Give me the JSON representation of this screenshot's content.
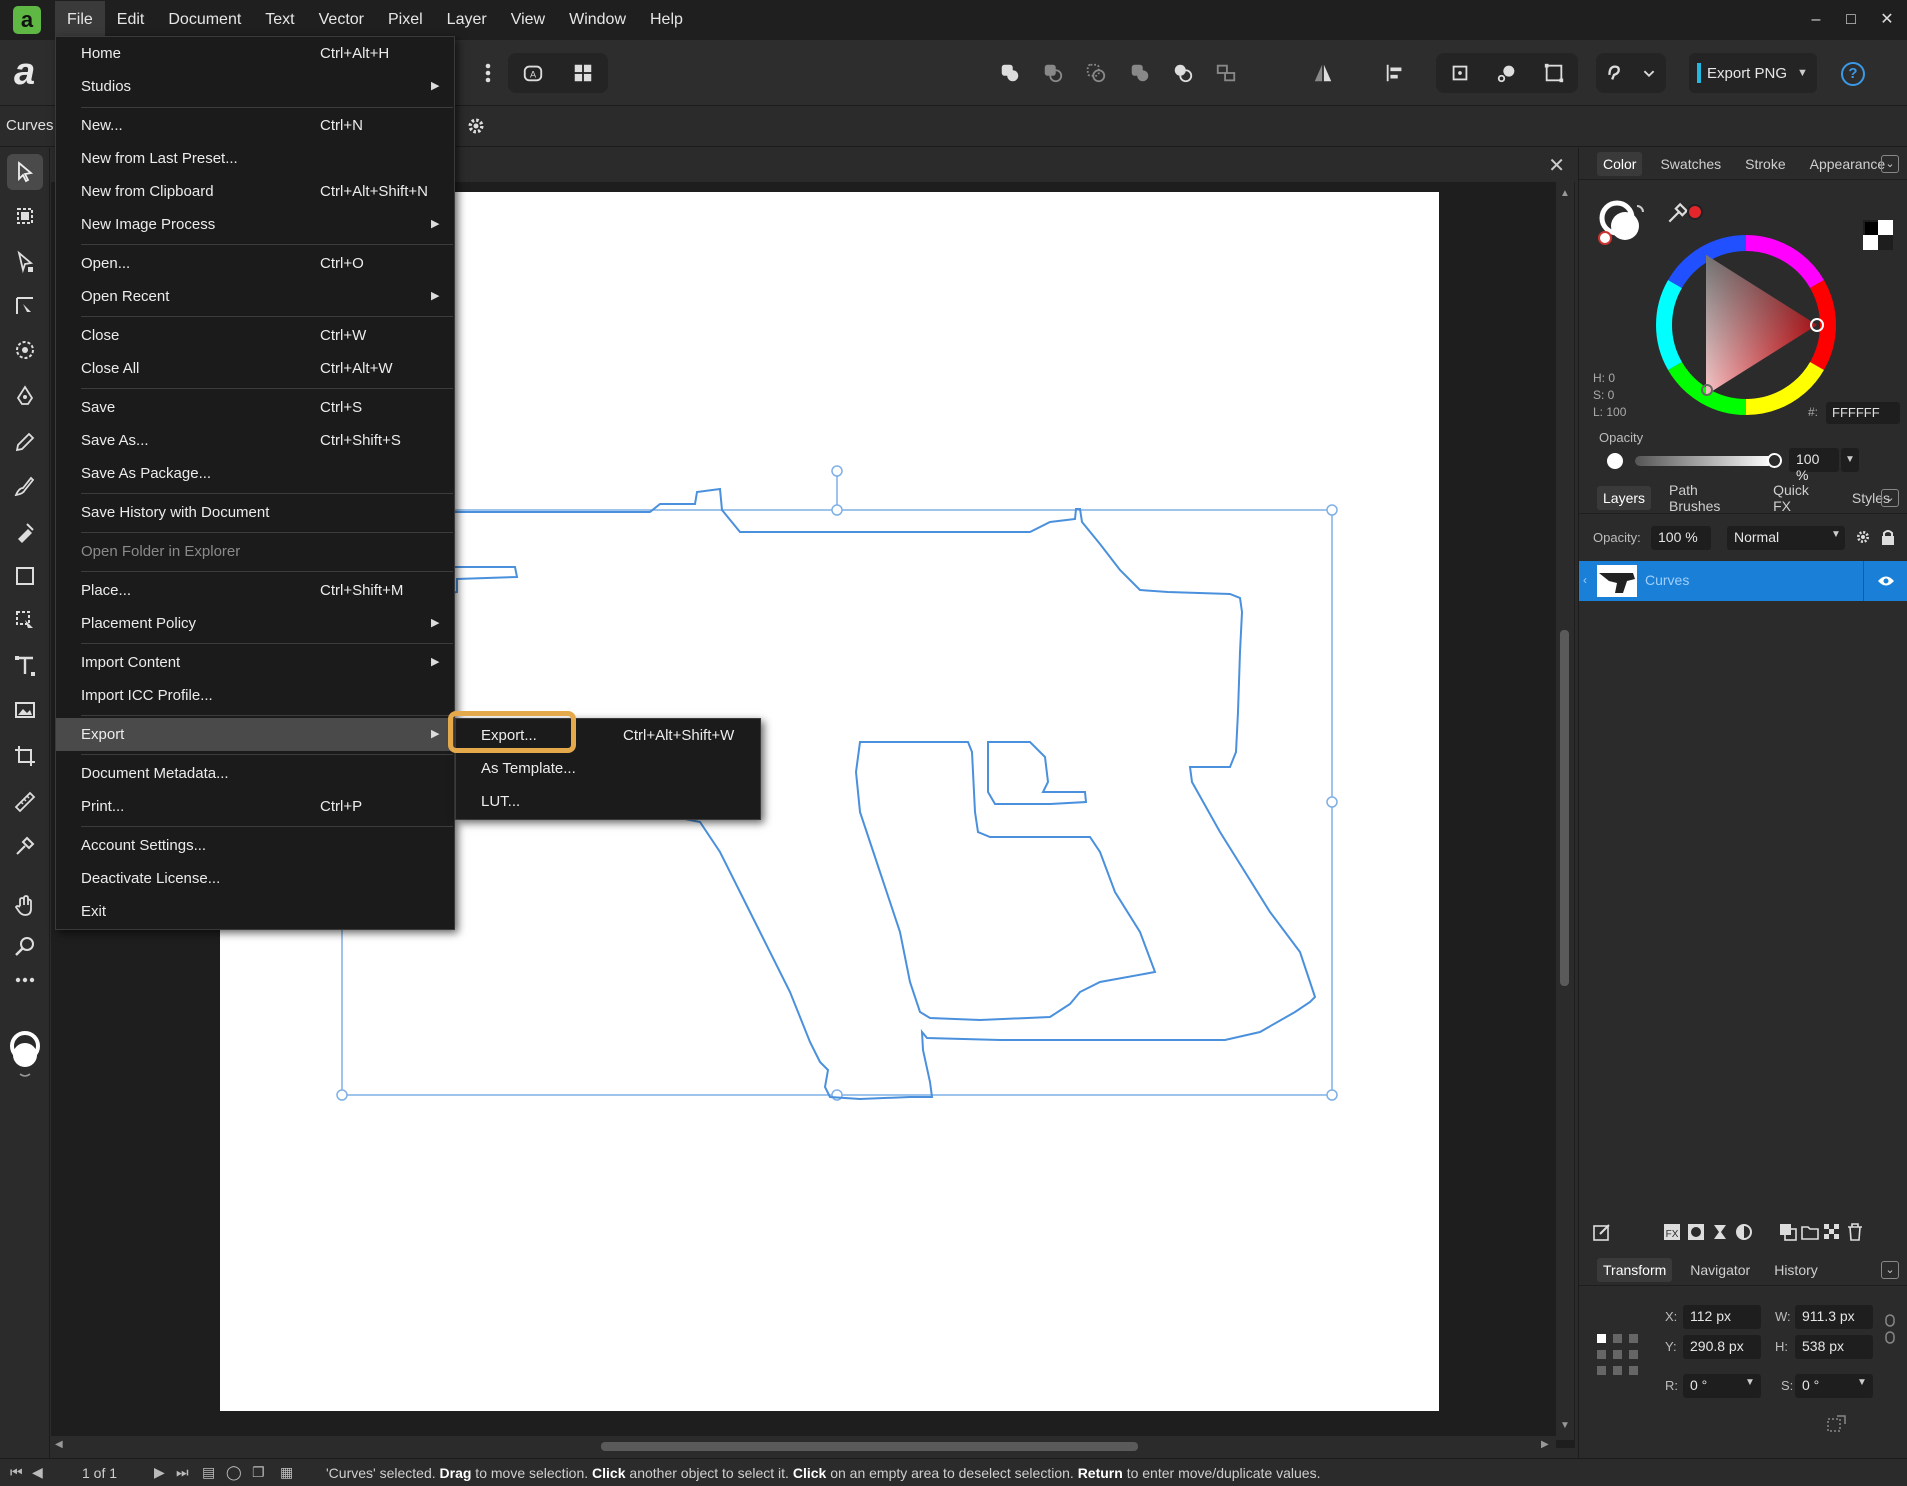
{
  "menubar": {
    "logo": "a",
    "items": [
      "File",
      "Edit",
      "Document",
      "Text",
      "Vector",
      "Pixel",
      "Layer",
      "View",
      "Window",
      "Help"
    ],
    "active": "File"
  },
  "toolbar": {
    "export_label": "Export PNG",
    "help": "?"
  },
  "context": {
    "label": "Curves"
  },
  "file_menu": {
    "items": [
      {
        "label": "Home",
        "shortcut": "Ctrl+Alt+H"
      },
      {
        "label": "Studios",
        "submenu": true
      },
      {
        "label": "New...",
        "shortcut": "Ctrl+N"
      },
      {
        "label": "New from Last Preset..."
      },
      {
        "label": "New from Clipboard",
        "shortcut": "Ctrl+Alt+Shift+N"
      },
      {
        "label": "New Image Process",
        "submenu": true
      },
      {
        "label": "Open...",
        "shortcut": "Ctrl+O"
      },
      {
        "label": "Open Recent",
        "submenu": true
      },
      {
        "label": "Close",
        "shortcut": "Ctrl+W"
      },
      {
        "label": "Close All",
        "shortcut": "Ctrl+Alt+W"
      },
      {
        "label": "Save",
        "shortcut": "Ctrl+S"
      },
      {
        "label": "Save As...",
        "shortcut": "Ctrl+Shift+S"
      },
      {
        "label": "Save As Package..."
      },
      {
        "label": "Save History with Document"
      },
      {
        "label": "Open Folder in Explorer",
        "disabled": true
      },
      {
        "label": "Place...",
        "shortcut": "Ctrl+Shift+M"
      },
      {
        "label": "Placement Policy",
        "submenu": true
      },
      {
        "label": "Import Content",
        "submenu": true
      },
      {
        "label": "Import ICC Profile..."
      },
      {
        "label": "Export",
        "submenu": true,
        "highlighted": true
      },
      {
        "label": "Document Metadata..."
      },
      {
        "label": "Print...",
        "shortcut": "Ctrl+P"
      },
      {
        "label": "Account Settings..."
      },
      {
        "label": "Deactivate License..."
      },
      {
        "label": "Exit"
      }
    ]
  },
  "export_submenu": {
    "items": [
      {
        "label": "Export...",
        "shortcut": "Ctrl+Alt+Shift+W"
      },
      {
        "label": "As Template..."
      },
      {
        "label": "LUT..."
      }
    ]
  },
  "color_panel": {
    "tabs": [
      "Color",
      "Swatches",
      "Stroke",
      "Appearance"
    ],
    "selected_tab": "Color",
    "h": "H: 0",
    "s": "S: 0",
    "l": "L: 100",
    "hex_label": "#:",
    "hex": "FFFFFF",
    "opacity_label": "Opacity",
    "opacity": "100 %",
    "accent": "#e3262c"
  },
  "layers_panel": {
    "tabs": [
      "Layers",
      "Path Brushes",
      "Quick FX",
      "Styles"
    ],
    "selected_tab": "Layers",
    "opacity_label": "Opacity:",
    "opacity": "100 %",
    "blend_mode": "Normal",
    "layers": [
      {
        "name": "Curves",
        "selected": true,
        "visible": true
      }
    ]
  },
  "transform_panel": {
    "tabs": [
      "Transform",
      "Navigator",
      "History"
    ],
    "selected_tab": "Transform",
    "x_label": "X:",
    "x": "112 px",
    "y_label": "Y:",
    "y": "290.8 px",
    "w_label": "W:",
    "w": "911.3 px",
    "h_label": "H:",
    "h": "538 px",
    "r_label": "R:",
    "r": "0 °",
    "s_label": "S:",
    "s": "0 °"
  },
  "statusbar": {
    "page": "1 of 1",
    "msg_pre": "'Curves' selected. ",
    "drag": "Drag",
    "msg1": " to move selection. ",
    "click1": "Click",
    "msg2": " another object to select it. ",
    "click2": "Click",
    "msg3": " on an empty area to deselect selection. ",
    "return": "Return",
    "msg4": " to enter move/duplicate values."
  }
}
